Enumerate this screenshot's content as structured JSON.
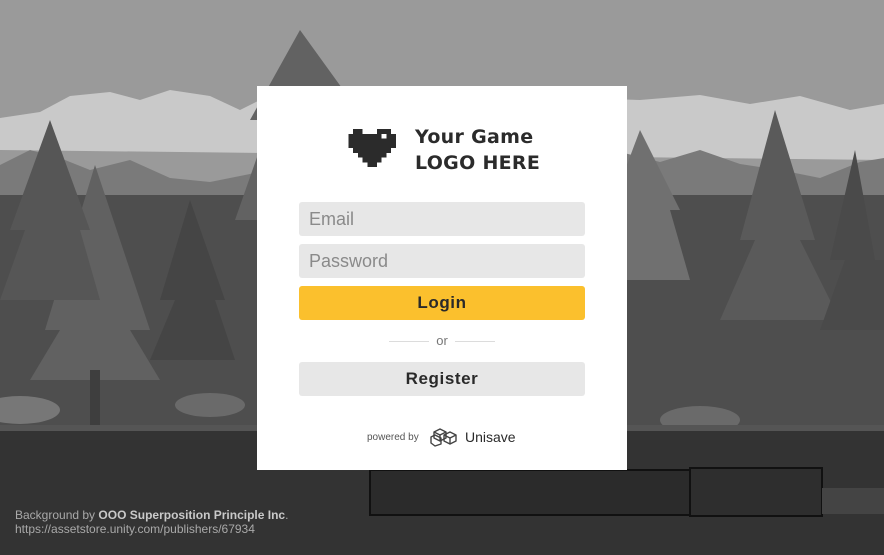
{
  "logo": {
    "line1": "Your Game",
    "line2": "LOGO HERE",
    "icon": "pixel-heart-icon"
  },
  "form": {
    "email_placeholder": "Email",
    "password_placeholder": "Password",
    "login_label": "Login",
    "divider_label": "or",
    "register_label": "Register"
  },
  "footer": {
    "powered_by": "powered by",
    "brand": "Unisave",
    "brand_icon": "unisave-cubes-icon"
  },
  "credit": {
    "prefix": "Background by",
    "author": "OOO Superposition Principle Inc",
    "suffix": ".",
    "url": "https://assetstore.unity.com/publishers/67934"
  },
  "colors": {
    "login_button": "#fbc02d",
    "secondary_button": "#e7e7e7",
    "card": "#ffffff",
    "text_dark": "#2b2b2b"
  }
}
